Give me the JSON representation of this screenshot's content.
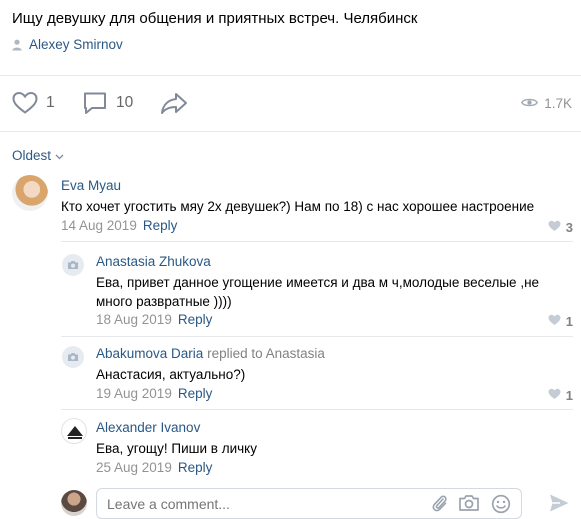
{
  "post": {
    "title": "Ищу девушку для общения и приятных встреч. Челябинск",
    "author": "Alexey Smirnov"
  },
  "actions": {
    "likes": "1",
    "comments": "10",
    "views": "1.7K"
  },
  "sort": {
    "label": "Oldest"
  },
  "comments": [
    {
      "name": "Eva Myau",
      "text": "Кто хочет угостить мяу 2х девушек?) Нам по 18) с нас хорошее настроение",
      "date": "14 Aug 2019",
      "reply": "Reply",
      "likes": "3"
    },
    {
      "name": "Anastasia Zhukova",
      "text": "Ева, привет данное угощение имеется и два м ч,молодые веселые ,не много развратные ))))",
      "date": "18 Aug 2019",
      "reply": "Reply",
      "likes": "1"
    },
    {
      "name": "Abakumova Daria",
      "replied_to": "replied to Anastasia",
      "text": "Анастасия, актуально?)",
      "date": "19 Aug 2019",
      "reply": "Reply",
      "likes": "1"
    },
    {
      "name": "Alexander Ivanov",
      "text": "Ева, угощу! Пиши в личку",
      "date": "25 Aug 2019",
      "reply": "Reply"
    }
  ],
  "composer": {
    "placeholder": "Leave a comment..."
  },
  "colors": {
    "link": "#2a5885",
    "muted": "#939393",
    "divider": "#e7e8ec"
  },
  "icons": [
    "person-icon",
    "heart-icon",
    "comment-icon",
    "share-icon",
    "eye-icon",
    "chevron-down-icon",
    "camera-icon",
    "paperclip-icon",
    "smile-icon",
    "send-icon"
  ]
}
